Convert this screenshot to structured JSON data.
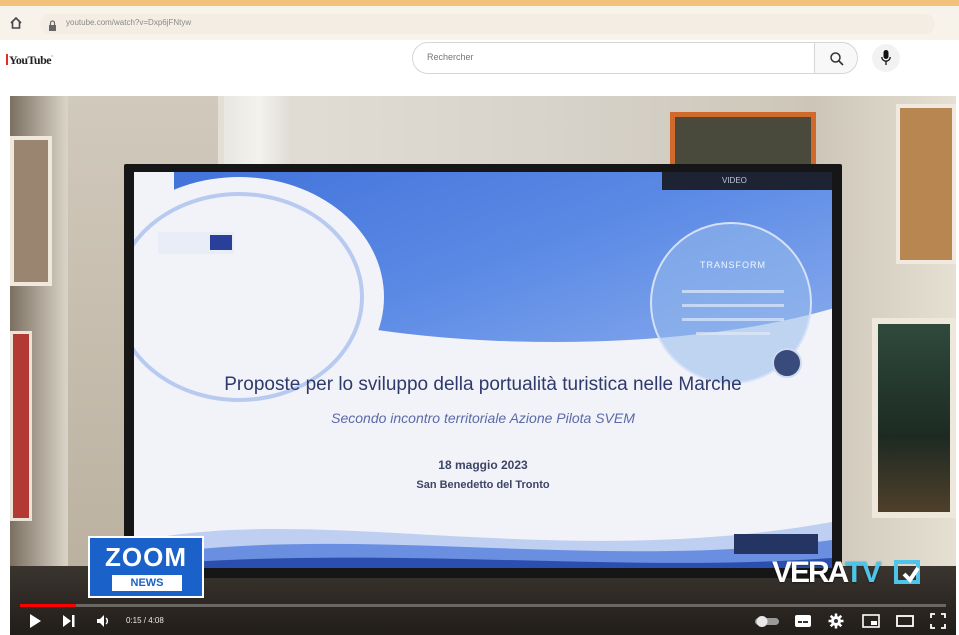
{
  "browser": {
    "url": "youtube.com/watch?v=Dxp6jFNtyw"
  },
  "header": {
    "logo_text": "YouTube",
    "search_placeholder": "Rechercher"
  },
  "slide": {
    "top_bar_label": "VIDEO",
    "circle_title": "TRANSFORM",
    "title": "Proposte per lo sviluppo della portualità turistica nelle Marche",
    "subtitle": "Secondo incontro territoriale Azione Pilota SVEM",
    "date": "18 maggio 2023",
    "place": "San Benedetto del Tronto"
  },
  "overlays": {
    "zoom_logo": "ZOOM",
    "zoom_news": "NEWS",
    "vera_text": "VERA",
    "vera_tv": "TV"
  },
  "player": {
    "time": "0:15 / 4:08",
    "progress_fraction": 0.06,
    "accent_color": "#ff0000"
  }
}
